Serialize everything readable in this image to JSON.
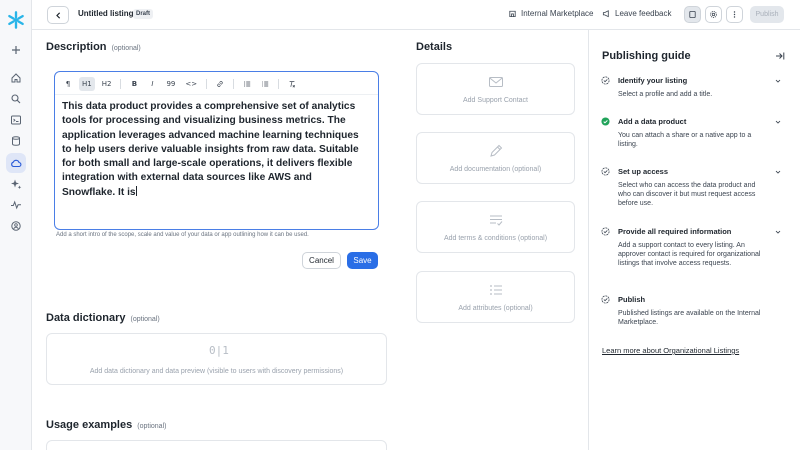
{
  "topbar": {
    "title": "Untitled listing",
    "badge": "Draft",
    "internal_marketplace": "Internal Marketplace",
    "leave_feedback": "Leave feedback",
    "publish": "Publish"
  },
  "description": {
    "heading": "Description",
    "optional": "(optional)",
    "toolbar": [
      "¶",
      "H1",
      "H2",
      "B",
      "I",
      "99",
      "<>",
      "link",
      "ul",
      "ol",
      "clear"
    ],
    "content": "This data product provides a comprehensive set of analytics tools for processing and visualizing business metrics. The application leverages advanced machine learning techniques to help users derive valuable insights from raw data. Suitable for both small and large-scale operations, it delivers flexible integration with external data sources like AWS and Snowflake. It is",
    "helper": "Add a short intro of the scope, scale and value of your data or app outlining how it can be used.",
    "cancel": "Cancel",
    "save": "Save"
  },
  "data_dictionary": {
    "heading": "Data dictionary",
    "optional": "(optional)",
    "placeholder": "Add data dictionary and data preview (visible to users with discovery permissions)"
  },
  "usage_examples": {
    "heading": "Usage examples",
    "optional": "(optional)"
  },
  "details": {
    "heading": "Details",
    "cards": [
      {
        "label": "Add Support Contact",
        "icon": "mail-icon"
      },
      {
        "label": "Add documentation (optional)",
        "icon": "pencil-icon"
      },
      {
        "label": "Add terms & conditions (optional)",
        "icon": "terms-icon"
      },
      {
        "label": "Add attributes (optional)",
        "icon": "list-icon"
      }
    ]
  },
  "guide": {
    "title": "Publishing guide",
    "steps": [
      {
        "title": "Identify your listing",
        "desc": "Select a profile and add a title.",
        "status": "pending"
      },
      {
        "title": "Add a data product",
        "desc": "You can attach a share or a native app to a listing.",
        "status": "done"
      },
      {
        "title": "Set up access",
        "desc": "Select who can access the data product and who can discover it but must request access before use.",
        "status": "pending"
      },
      {
        "title": "Provide all required information",
        "desc": "Add a support contact to every listing. An approver contact is required for organizational listings that involve access requests.",
        "status": "pending"
      },
      {
        "title": "Publish",
        "desc": "Published listings are available on the Internal Marketplace.",
        "status": "pending"
      }
    ],
    "link": "Learn more about Organizational Listings"
  },
  "colors": {
    "accent": "#2a6ee6",
    "done": "#21a35a"
  }
}
